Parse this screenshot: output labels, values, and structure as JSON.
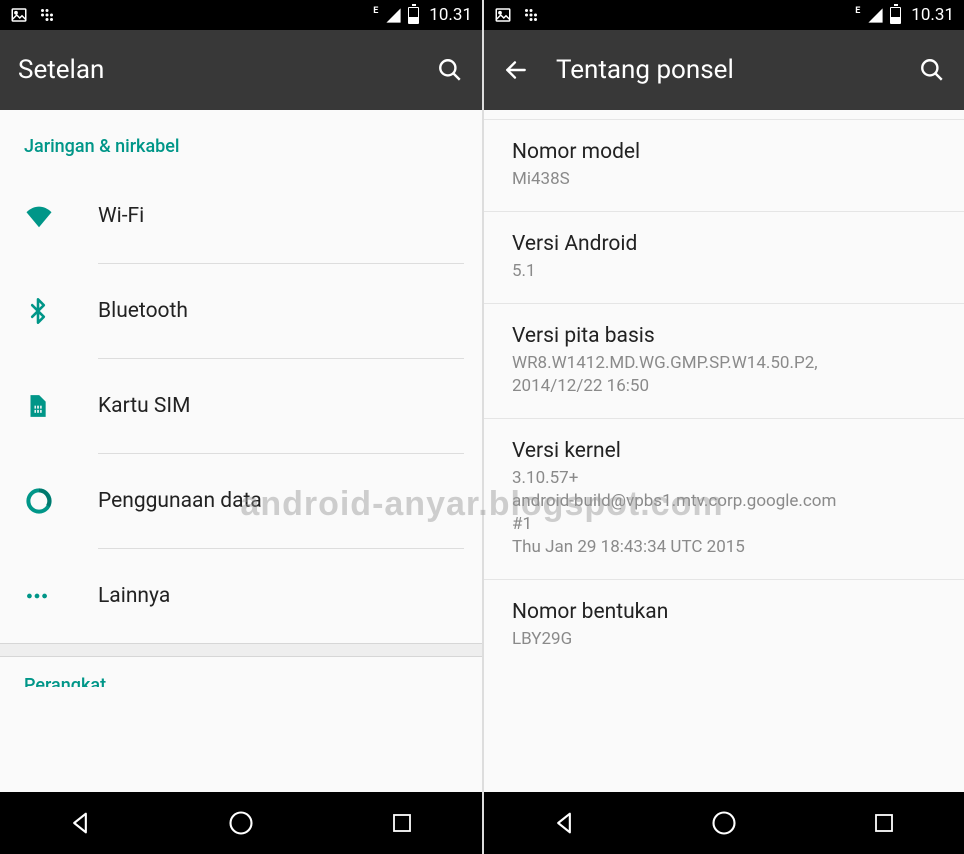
{
  "statusbar": {
    "time": "10.31",
    "network_type": "E"
  },
  "watermark": "android-anyar.blogspot.com",
  "left": {
    "title": "Setelan",
    "section_wireless": "Jaringan & nirkabel",
    "items": {
      "wifi": "Wi-Fi",
      "bluetooth": "Bluetooth",
      "sim": "Kartu SIM",
      "data_usage": "Penggunaan data",
      "more": "Lainnya"
    },
    "section_device_partial": "Perangkat"
  },
  "right": {
    "title": "Tentang ponsel",
    "items": {
      "model": {
        "title": "Nomor model",
        "value": "Mi438S"
      },
      "android_version": {
        "title": "Versi Android",
        "value": "5.1"
      },
      "baseband": {
        "title": "Versi pita basis",
        "value": "WR8.W1412.MD.WG.GMP.SP.W14.50.P2,\n2014/12/22 16:50"
      },
      "kernel": {
        "title": "Versi kernel",
        "value": "3.10.57+\nandroid-build@vpbs1.mtv.corp.google.com\n#1\nThu Jan 29 18:43:34 UTC 2015"
      },
      "build": {
        "title": "Nomor bentukan",
        "value": "LBY29G"
      }
    }
  }
}
